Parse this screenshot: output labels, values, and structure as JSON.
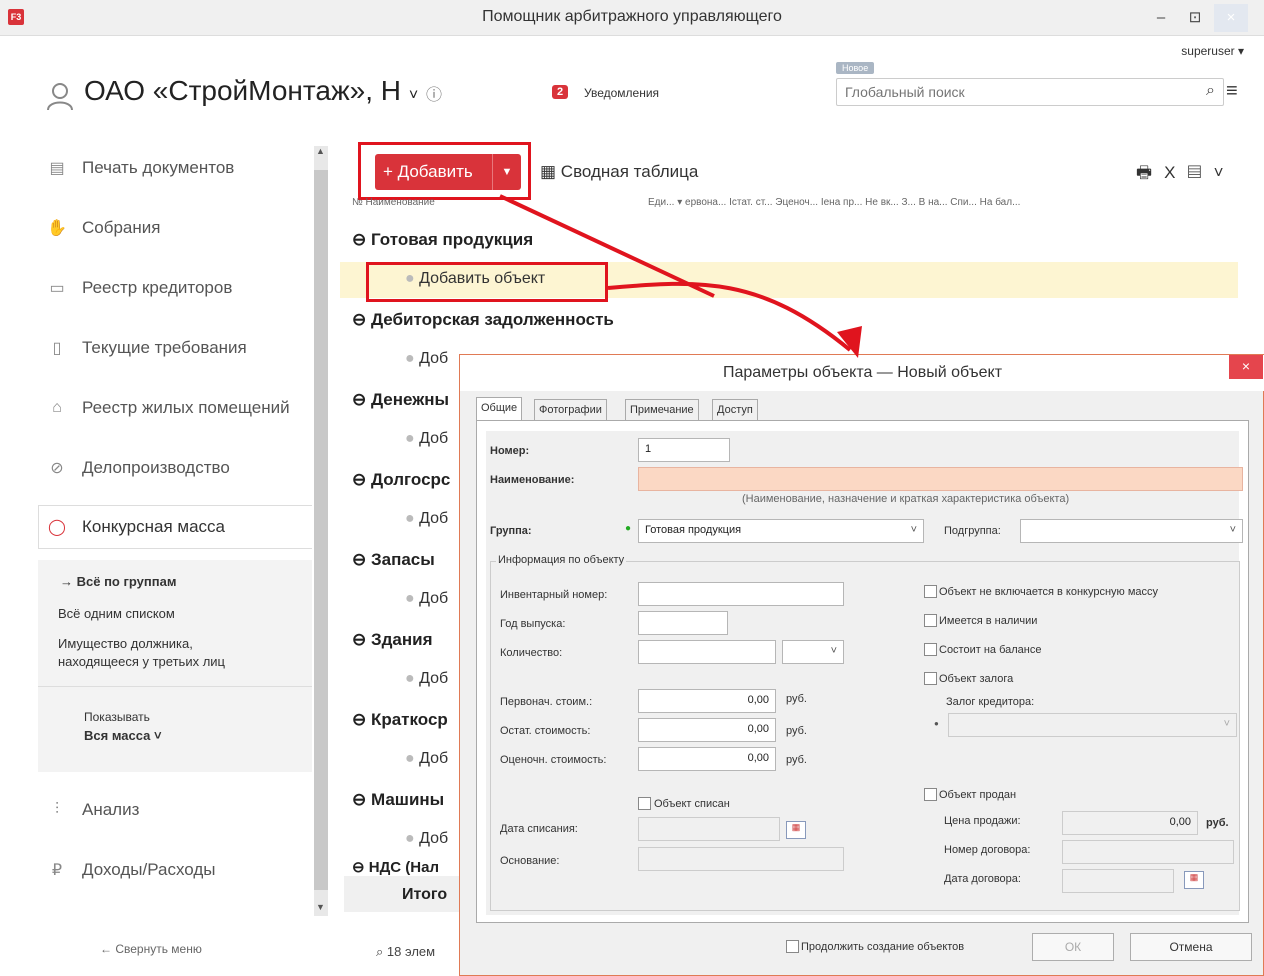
{
  "window": {
    "app_icon": "F3",
    "title": "Помощник арбитражного управляющего",
    "minimize": "–",
    "maximize": "⊡",
    "close": "×"
  },
  "header": {
    "user": "superuser ▾",
    "org_title": "ОАО «СтройМонтаж», Н",
    "info_icon": "ⓘ",
    "notifications_count": "2",
    "notifications_label": "Уведомления",
    "new_tag": "Новое",
    "search_placeholder": "Глобальный поиск"
  },
  "sidebar": {
    "items": [
      {
        "icon": "document-icon",
        "label": "Печать документов"
      },
      {
        "icon": "handshake-icon",
        "label": "Собрания"
      },
      {
        "icon": "card-icon",
        "label": "Реестр кредиторов"
      },
      {
        "icon": "requirement-icon",
        "label": "Текущие требования"
      },
      {
        "icon": "house-icon",
        "label": "Реестр жилых помещений"
      },
      {
        "icon": "paperclip-icon",
        "label": "Делопроизводство"
      },
      {
        "icon": "bag-icon",
        "label": "Конкурсная масса"
      },
      {
        "icon": "chart-icon",
        "label": "Анализ"
      },
      {
        "icon": "ruble-icon",
        "label": "Доходы/Расходы"
      }
    ],
    "sub_items": [
      "→ Всё по группам",
      "Всё одним списком",
      "Имущество должника,",
      "находящееся у третьих лиц"
    ],
    "show_label": "Показывать",
    "show_value": "Вся масса ˅",
    "collapse": "← Свернуть меню"
  },
  "toolbar": {
    "add_label": "+ Добавить",
    "pivot_label": "Сводная таблица",
    "icons": "🖶 X"
  },
  "table": {
    "columns": "№  Наименование",
    "right_columns": "Еди... ▾   ервона...   Істат. ст...   Эценоч...   Іена пр...   Не вк...  З...  В на...  Спи...  На бал...",
    "groups": [
      "Готовая продукция",
      "Дебиторская задолженность",
      "Денежны",
      "Долгосрс",
      "Запасы",
      "Здания",
      "Краткоср",
      "Машины",
      "НДС (Нал"
    ],
    "add_object": "Добавить объект",
    "add_object_short": "Доб",
    "total": "Итого",
    "status": "18 элем"
  },
  "dialog": {
    "title": "Параметры объекта — Новый объект",
    "close": "×",
    "tabs": [
      "Общие",
      "Фотографии",
      "Примечание",
      "Доступ"
    ],
    "number_label": "Номер:",
    "number_value": "1",
    "name_label": "Наименование:",
    "name_hint": "(Наименование, назначение и краткая характеристика объекта)",
    "group_label": "Группа:",
    "group_value": "Готовая продукция",
    "subgroup_label": "Подгруппа:",
    "info_section": "Информация по объекту",
    "inventory_label": "Инвентарный номер:",
    "year_label": "Год выпуска:",
    "qty_label": "Количество:",
    "initial_cost_label": "Первонач. стоим.:",
    "initial_cost": "0,00",
    "residual_label": "Остат. стоимость:",
    "residual_cost": "0,00",
    "appraised_label": "Оценочн. стоимость:",
    "appraised_cost": "0,00",
    "rub": "руб.",
    "written_off": "Объект списан",
    "writeoff_date_label": "Дата списания:",
    "basis_label": "Основание:",
    "cb_excluded": "Объект не включается в конкурсную массу",
    "cb_available": "Имеется в наличии",
    "cb_balance": "Состоит на балансе",
    "cb_pledge": "Объект залога",
    "pledge_creditor_label": "Залог кредитора:",
    "cb_sold": "Объект продан",
    "sale_price_label": "Цена продажи:",
    "sale_price": "0,00",
    "contract_no_label": "Номер договора:",
    "contract_date_label": "Дата договора:",
    "continue_label": "Продолжить создание объектов",
    "ok": "ОК",
    "cancel": "Отмена"
  }
}
